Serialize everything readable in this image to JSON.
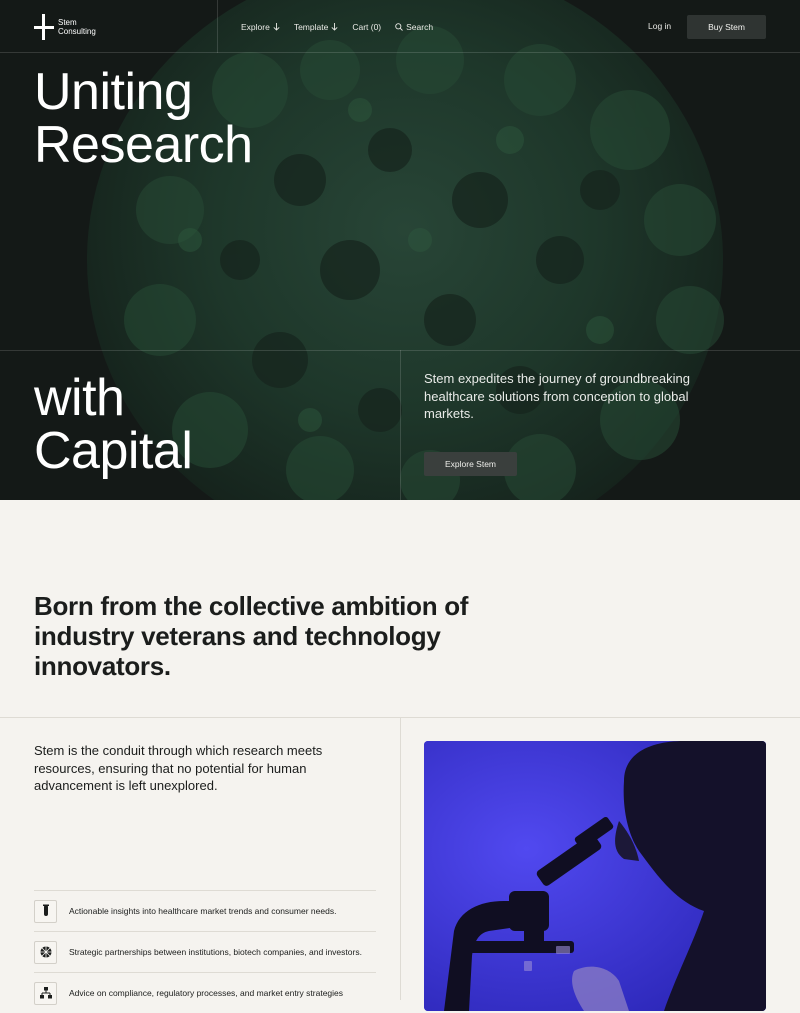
{
  "brand": {
    "name_line1": "Stem",
    "name_line2": "Consulting"
  },
  "nav": {
    "links": [
      {
        "label": "Explore",
        "icon": "arrow-down-icon"
      },
      {
        "label": "Template",
        "icon": "arrow-down-icon"
      },
      {
        "label": "Cart (0)"
      },
      {
        "label": "Search",
        "icon": "search-icon"
      }
    ],
    "login_label": "Log in",
    "buy_label": "Buy Stem"
  },
  "hero": {
    "heading_top_line1": "Uniting",
    "heading_top_line2": "Research",
    "heading_bottom_line1": "with",
    "heading_bottom_line2": "Capital",
    "description": "Stem expedites the journey of groundbreaking healthcare solutions from conception to global markets.",
    "cta_label": "Explore Stem"
  },
  "intro": {
    "heading": "Born from the collective ambition of industry veterans and technology innovators."
  },
  "about": {
    "text": "Stem is the conduit through which research meets resources, ensuring that no potential for human advancement is left unexplored.",
    "features": [
      {
        "icon": "test-tube-icon",
        "text": "Actionable insights into healthcare market trends and consumer needs."
      },
      {
        "icon": "network-globe-icon",
        "text": "Strategic partnerships between institutions, biotech companies, and investors."
      },
      {
        "icon": "hierarchy-icon",
        "text": "Advice on compliance, regulatory processes, and market entry strategies"
      }
    ]
  },
  "colors": {
    "hero_bg": "#141917",
    "page_bg": "#f5f3ef",
    "photo_bg": "#3b36d8"
  }
}
